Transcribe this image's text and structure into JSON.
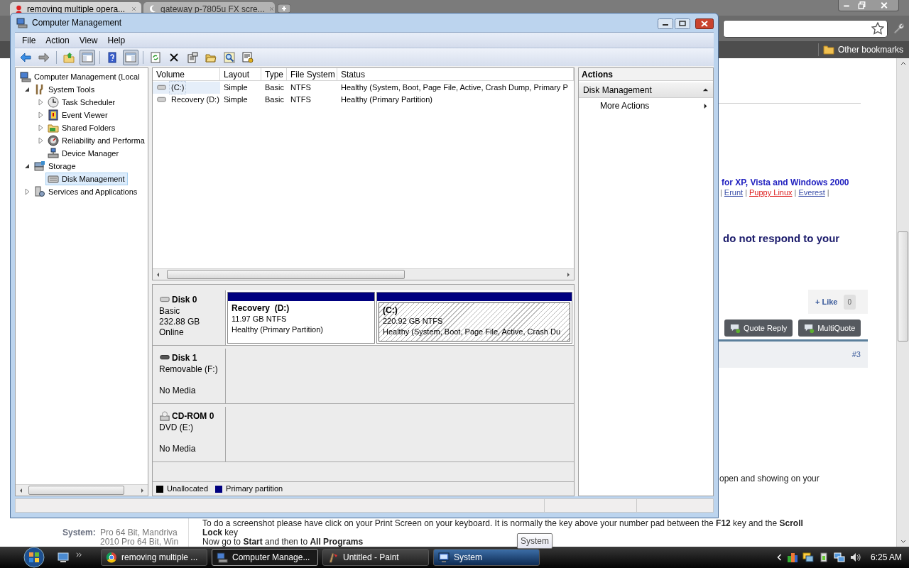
{
  "browser": {
    "tabs": [
      {
        "title": "removing multiple opera...",
        "selected": true
      },
      {
        "title": "gateway p-7805u FX scre...",
        "selected": false
      }
    ],
    "bookmarks": [
      "Other bookmarks"
    ],
    "page": {
      "heading": "for XP, Vista and Windows 2000",
      "link_line": [
        {
          "kind": "separator",
          "text": "|"
        },
        {
          "kind": "link",
          "text": "Erunt",
          "color": "#3b4fa8"
        },
        {
          "kind": "separator",
          "text": "|"
        },
        {
          "kind": "link",
          "text": "Puppy Linux",
          "color": "#dd1c1c"
        },
        {
          "kind": "separator",
          "text": "|"
        },
        {
          "kind": "link",
          "text": "Everest",
          "color": "#3b4fa8"
        },
        {
          "kind": "separator",
          "text": "|"
        }
      ],
      "notice": "do not respond to your",
      "like": {
        "label": "+ Like",
        "count": "0"
      },
      "post_buttons": [
        "Quote Reply",
        "MultiQuote"
      ],
      "post_number": "#3",
      "paragraph_fragment": "open and showing on your",
      "sidebar": {
        "label": "System:",
        "lines": [
          "Pro 64 Bit, Mandriva",
          "2010 Pro 64 Bit, Win"
        ]
      },
      "body_lines": [
        "To do a screenshot please have click on your Print Screen on your keyboard. It is normally the key above your number pad between the **F12** key and the **Scroll**",
        "**Lock** key",
        "Now go to **Start** and then to **All Programs**"
      ]
    }
  },
  "window": {
    "title": "Computer Management",
    "menu": [
      "File",
      "Action",
      "View",
      "Help"
    ],
    "toolbar": [
      {
        "kind": "back",
        "pressed": false
      },
      {
        "kind": "forward",
        "pressed": false
      },
      {
        "kind": "up",
        "pressed": false
      },
      {
        "kind": "tree",
        "pressed": true
      },
      {
        "kind": "help",
        "pressed": false
      },
      {
        "kind": "actionpane",
        "pressed": true
      },
      {
        "kind": "refresh",
        "pressed": false
      },
      {
        "kind": "delete",
        "pressed": false
      },
      {
        "kind": "properties",
        "pressed": false
      },
      {
        "kind": "open",
        "pressed": false
      },
      {
        "kind": "search",
        "pressed": false
      },
      {
        "kind": "settings",
        "pressed": false
      }
    ],
    "tree": [
      {
        "label": "Computer Management (Local",
        "kind": "computer",
        "selected": false,
        "children": [
          {
            "label": "System Tools",
            "kind": "tools",
            "expanded": true,
            "selected": false,
            "children": [
              {
                "label": "Task Scheduler",
                "kind": "clock",
                "expanded": false,
                "selected": false
              },
              {
                "label": "Event Viewer",
                "kind": "log",
                "expanded": false,
                "selected": false
              },
              {
                "label": "Shared Folders",
                "kind": "share",
                "expanded": false,
                "selected": false
              },
              {
                "label": "Reliability and Performa",
                "kind": "gauge",
                "expanded": false,
                "selected": false
              },
              {
                "label": "Device Manager",
                "kind": "devices",
                "selected": false
              }
            ]
          },
          {
            "label": "Storage",
            "kind": "storage",
            "expanded": true,
            "selected": false,
            "children": [
              {
                "label": "Disk Management",
                "kind": "disk",
                "selected": true
              }
            ]
          },
          {
            "label": "Services and Applications",
            "kind": "services",
            "expanded": false,
            "selected": false
          }
        ]
      }
    ],
    "volumes": {
      "columns": [
        "Volume",
        "Layout",
        "Type",
        "File System",
        "Status"
      ],
      "rows": [
        {
          "selected": true,
          "cells": [
            "(C:)",
            "Simple",
            "Basic",
            "NTFS",
            "Healthy (System, Boot, Page File, Active, Crash Dump, Primary P"
          ]
        },
        {
          "selected": false,
          "cells": [
            "Recovery (D:)",
            "Simple",
            "Basic",
            "NTFS",
            "Healthy (Primary Partition)"
          ]
        }
      ]
    },
    "disks": [
      {
        "kind": "hdd",
        "name": "Disk 0",
        "type": "Basic",
        "size": "232.88 GB",
        "status": "Online",
        "partitions": [
          {
            "name": "Recovery  (D:)",
            "size": "11.97 GB NTFS",
            "status": "Healthy (Primary Partition)",
            "selected": false
          },
          {
            "name": "(C:)",
            "size": "220.92 GB NTFS",
            "status": "Healthy (System, Boot, Page File, Active, Crash Du",
            "selected": true
          }
        ]
      },
      {
        "kind": "removable",
        "name": "Disk 1",
        "type": "Removable (F:)",
        "status": "No Media"
      },
      {
        "kind": "cdrom",
        "name": "CD-ROM 0",
        "type": "DVD (E:)",
        "status": "No Media"
      }
    ],
    "legend": [
      {
        "label": "Unallocated",
        "color": "#000000"
      },
      {
        "label": "Primary partition",
        "color": "#00007f"
      }
    ],
    "actions": [
      {
        "kind": "header",
        "label": "Actions"
      },
      {
        "kind": "section",
        "label": "Disk Management",
        "expanded": true
      },
      {
        "kind": "item",
        "label": "More Actions"
      }
    ]
  },
  "taskbar": {
    "buttons": [
      {
        "label": "removing multiple ...",
        "kind": "browser",
        "selected": false,
        "hovered": false
      },
      {
        "label": "Computer Manage...",
        "kind": "computer",
        "selected": true,
        "hovered": false
      },
      {
        "label": "Untitled - Paint",
        "kind": "paint",
        "selected": false,
        "hovered": false
      },
      {
        "label": "System",
        "kind": "system",
        "selected": false,
        "hovered": true
      }
    ],
    "clock": "6:25 AM"
  },
  "tooltip": "System"
}
